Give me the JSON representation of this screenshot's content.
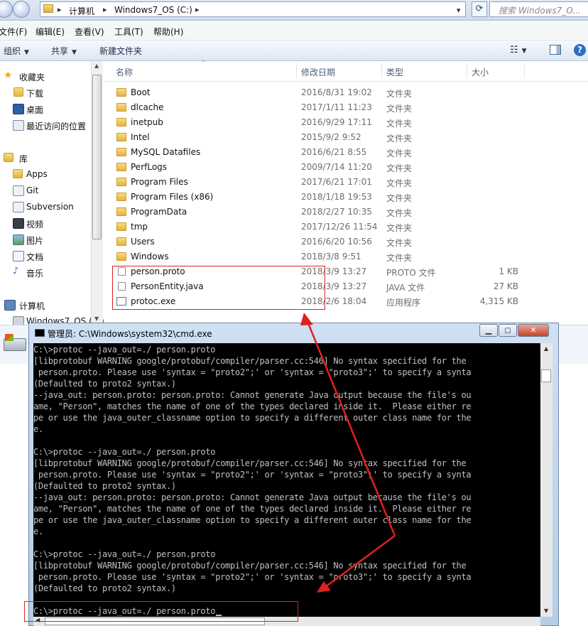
{
  "explorer": {
    "breadcrumb": [
      "计算机",
      "Windows7_OS (C:)"
    ],
    "search_placeholder": "搜索 Windows7_O...",
    "menu": [
      "文件(F)",
      "编辑(E)",
      "查看(V)",
      "工具(T)",
      "帮助(H)"
    ],
    "toolbar": {
      "organize": "组织",
      "share": "共享",
      "new_folder": "新建文件夹"
    },
    "nav": {
      "favorites": {
        "label": "收藏夹",
        "items": [
          "下载",
          "桌面",
          "最近访问的位置"
        ]
      },
      "library": {
        "label": "库",
        "items": [
          "Apps",
          "Git",
          "Subversion",
          "视频",
          "图片",
          "文档",
          "音乐"
        ]
      },
      "computer": {
        "label": "计算机",
        "items": [
          "Windows7_OS (C:)"
        ]
      }
    },
    "columns": [
      "名称",
      "修改日期",
      "类型",
      "大小"
    ],
    "files": [
      {
        "name": "Boot",
        "date": "2016/8/31 19:02",
        "type": "文件夹",
        "size": "",
        "kind": "folder"
      },
      {
        "name": "dlcache",
        "date": "2017/1/11 11:23",
        "type": "文件夹",
        "size": "",
        "kind": "folder"
      },
      {
        "name": "inetpub",
        "date": "2016/9/29 17:11",
        "type": "文件夹",
        "size": "",
        "kind": "folder"
      },
      {
        "name": "Intel",
        "date": "2015/9/2 9:52",
        "type": "文件夹",
        "size": "",
        "kind": "folder"
      },
      {
        "name": "MySQL Datafiles",
        "date": "2016/6/21 8:55",
        "type": "文件夹",
        "size": "",
        "kind": "folder"
      },
      {
        "name": "PerfLogs",
        "date": "2009/7/14 11:20",
        "type": "文件夹",
        "size": "",
        "kind": "folder"
      },
      {
        "name": "Program Files",
        "date": "2017/6/21 17:01",
        "type": "文件夹",
        "size": "",
        "kind": "folder"
      },
      {
        "name": "Program Files (x86)",
        "date": "2018/1/18 19:53",
        "type": "文件夹",
        "size": "",
        "kind": "folder"
      },
      {
        "name": "ProgramData",
        "date": "2018/2/27 10:35",
        "type": "文件夹",
        "size": "",
        "kind": "folder"
      },
      {
        "name": "tmp",
        "date": "2017/12/26 11:54",
        "type": "文件夹",
        "size": "",
        "kind": "folder"
      },
      {
        "name": "Users",
        "date": "2016/6/20 10:56",
        "type": "文件夹",
        "size": "",
        "kind": "folder"
      },
      {
        "name": "Windows",
        "date": "2018/3/8 9:51",
        "type": "文件夹",
        "size": "",
        "kind": "folder"
      },
      {
        "name": "person.proto",
        "date": "2018/3/9 13:27",
        "type": "PROTO 文件",
        "size": "1 KB",
        "kind": "doc"
      },
      {
        "name": "PersonEntity.java",
        "date": "2018/3/9 13:27",
        "type": "JAVA 文件",
        "size": "27 KB",
        "kind": "doc"
      },
      {
        "name": "protoc.exe",
        "date": "2018/2/6 18:04",
        "type": "应用程序",
        "size": "4,315 KB",
        "kind": "exe"
      }
    ]
  },
  "cmd": {
    "title": "管理员: C:\\Windows\\system32\\cmd.exe",
    "lines": [
      "C:\\>protoc --java_out=./ person.proto",
      "[libprotobuf WARNING google/protobuf/compiler/parser.cc:546] No syntax specified for the",
      " person.proto. Please use 'syntax = \"proto2\";' or 'syntax = \"proto3\";' to specify a synta",
      "(Defaulted to proto2 syntax.)",
      "--java_out: person.proto: person.proto: Cannot generate Java output because the file's ou",
      "ame, \"Person\", matches the name of one of the types declared inside it.  Please either re",
      "pe or use the java_outer_classname option to specify a different outer class name for the",
      "e.",
      "",
      "C:\\>protoc --java_out=./ person.proto",
      "[libprotobuf WARNING google/protobuf/compiler/parser.cc:546] No syntax specified for the",
      " person.proto. Please use 'syntax = \"proto2\";' or 'syntax = \"proto3\";' to specify a synta",
      "(Defaulted to proto2 syntax.)",
      "--java_out: person.proto: person.proto: Cannot generate Java output because the file's ou",
      "ame, \"Person\", matches the name of one of the types declared inside it.  Please either re",
      "pe or use the java_outer_classname option to specify a different outer class name for the",
      "e.",
      "",
      "C:\\>protoc --java_out=./ person.proto",
      "[libprotobuf WARNING google/protobuf/compiler/parser.cc:546] No syntax specified for the",
      " person.proto. Please use 'syntax = \"proto2\";' or 'syntax = \"proto3\";' to specify a synta",
      "(Defaulted to proto2 syntax.)",
      "",
      "C:\\>protoc --java_out=./ person.proto"
    ]
  },
  "colors": {
    "annotation_red": "#e02020",
    "console_bg": "#000000",
    "console_fg": "#c0c0c0"
  }
}
